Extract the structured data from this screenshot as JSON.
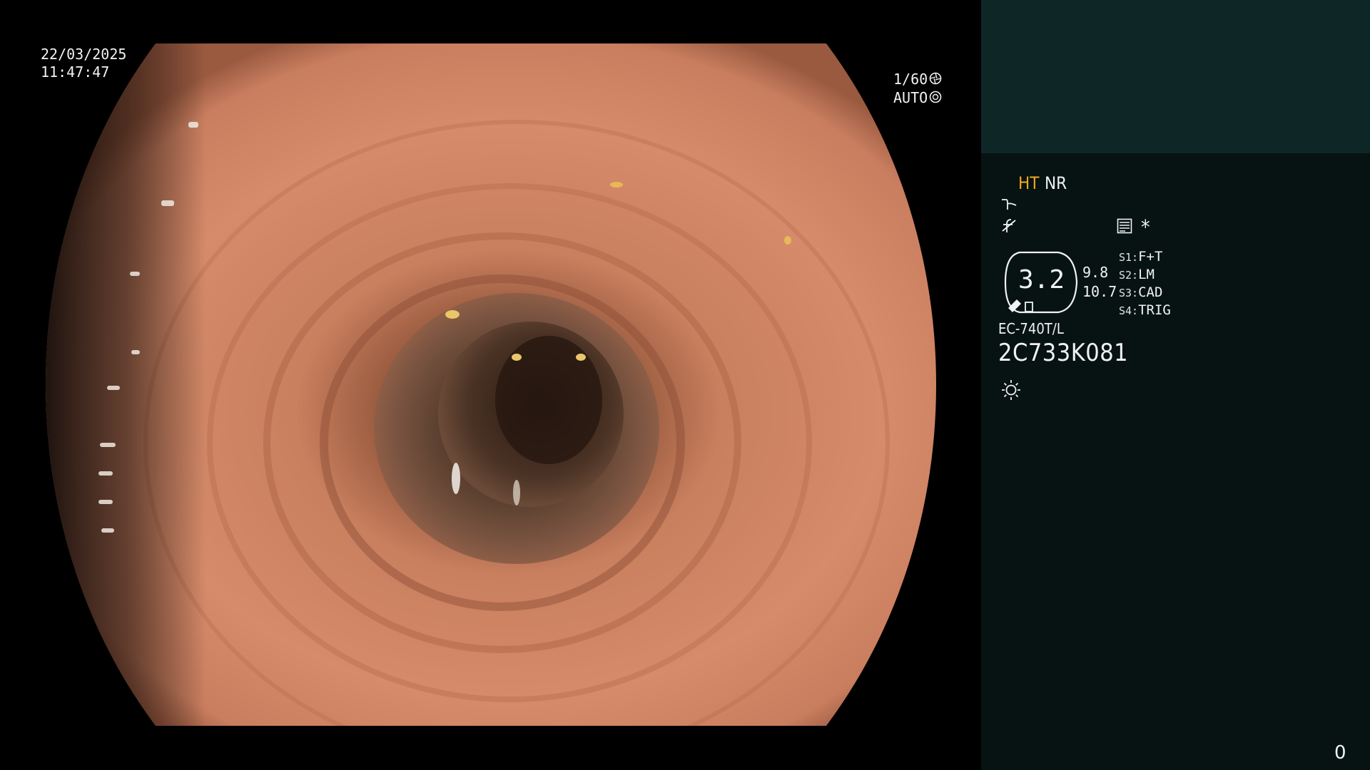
{
  "osd": {
    "date": "22/03/2025",
    "time": "11:47:47",
    "shutter": "1/60",
    "iris_mode": "AUTO"
  },
  "panel": {
    "ht_label": "HT",
    "nr_label": "NR",
    "asterisk": "*",
    "zoom_value": "3.2",
    "side_value_a": "9.8",
    "side_value_b": "10.7",
    "switches": [
      {
        "key": "S1:",
        "value": "F+T"
      },
      {
        "key": "S2:",
        "value": "LM"
      },
      {
        "key": "S3:",
        "value": "CAD"
      },
      {
        "key": "S4:",
        "value": "TRIG"
      }
    ],
    "scope_model": "EC-740T/L",
    "scope_serial": "2C733K081",
    "counter": "0"
  },
  "colors": {
    "ht_accent": "#f2a81d",
    "panel_top": "#0f2627",
    "panel_bg": "#071312"
  },
  "icons": [
    "shutter-icon",
    "iris-icon",
    "curve-icon",
    "f-not-icon",
    "list-icon",
    "zoom-badge-icon",
    "light-icon"
  ]
}
